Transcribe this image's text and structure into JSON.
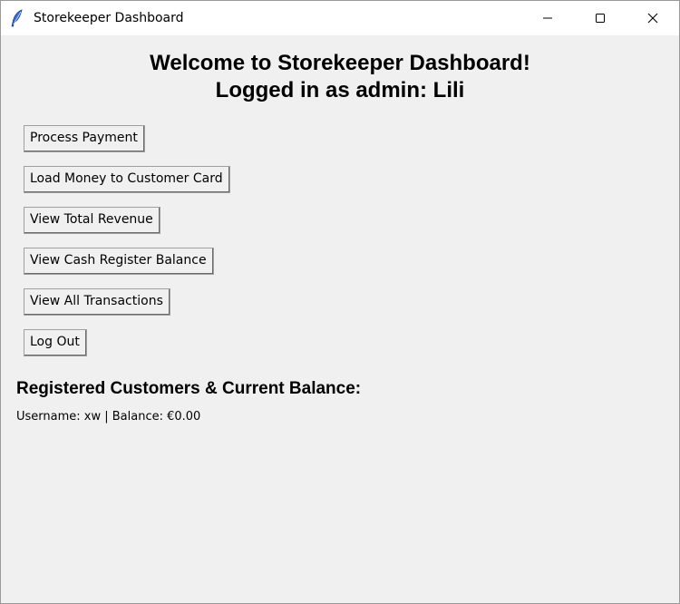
{
  "window": {
    "title": "Storekeeper Dashboard"
  },
  "heading": {
    "line1": "Welcome to Storekeeper Dashboard!",
    "line2": "Logged in as admin: Lili"
  },
  "actions": {
    "process_payment": "Process Payment",
    "load_money": "Load Money to Customer Card",
    "view_revenue": "View Total Revenue",
    "view_cash_register": "View Cash Register Balance",
    "view_transactions": "View All Transactions",
    "log_out": "Log Out"
  },
  "customers": {
    "section_title": "Registered Customers & Current Balance:",
    "rows": [
      "Username: xw | Balance: €0.00"
    ]
  }
}
